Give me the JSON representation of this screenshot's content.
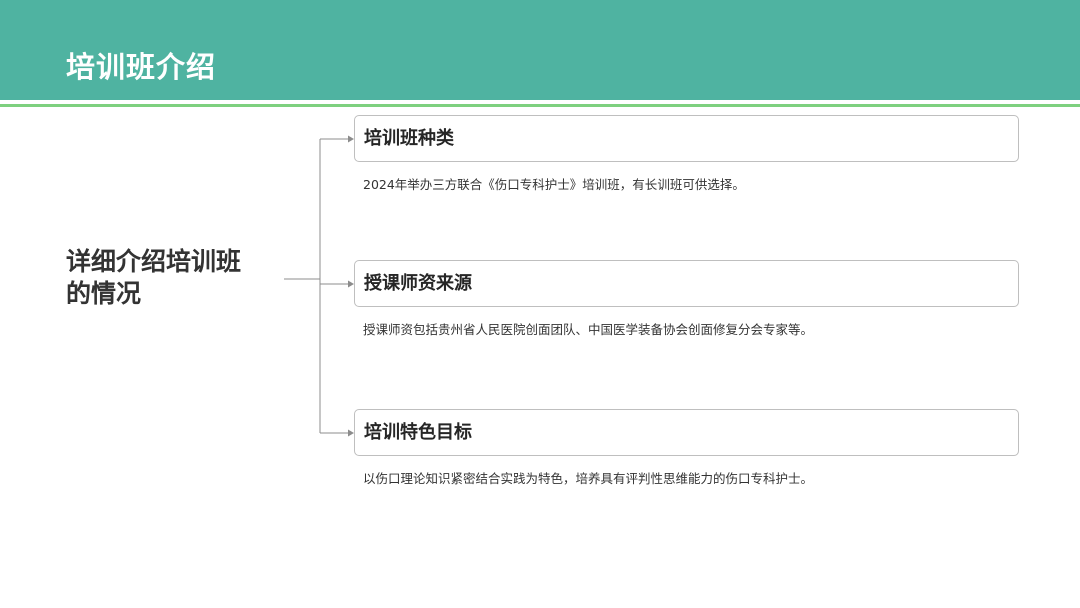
{
  "header": {
    "title": "培训班介绍"
  },
  "summary": {
    "line1": "详细介绍培训班",
    "line2": "的情况"
  },
  "items": [
    {
      "title": "培训班种类",
      "desc": "2024年举办三方联合《伤口专科护士》培训班，有长训班可供选择。"
    },
    {
      "title": "授课师资来源",
      "desc": "授课师资包括贵州省人民医院创面团队、中国医学装备协会创面修复分会专家等。"
    },
    {
      "title": "培训特色目标",
      "desc": "以伤口理论知识紧密结合实践为特色，培养具有评判性思维能力的伤口专科护士。"
    }
  ],
  "colors": {
    "header_bg": "#4fb3a1",
    "accent_line": "#7ed07f",
    "connector": "#8c8c8c"
  }
}
